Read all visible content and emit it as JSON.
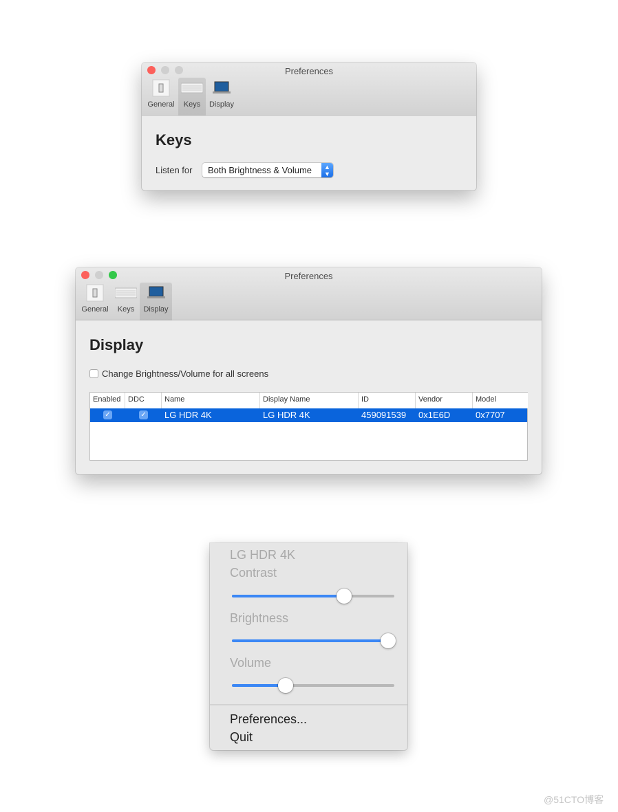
{
  "keys_window": {
    "title": "Preferences",
    "toolbar": [
      {
        "label": "General",
        "icon": "switch-icon"
      },
      {
        "label": "Keys",
        "icon": "keyboard-icon",
        "selected": true
      },
      {
        "label": "Display",
        "icon": "laptop-icon"
      }
    ],
    "heading": "Keys",
    "listen_label": "Listen for",
    "listen_value": "Both Brightness & Volume"
  },
  "display_window": {
    "title": "Preferences",
    "toolbar": [
      {
        "label": "General",
        "icon": "switch-icon"
      },
      {
        "label": "Keys",
        "icon": "keyboard-icon"
      },
      {
        "label": "Display",
        "icon": "laptop-icon",
        "selected": true
      }
    ],
    "heading": "Display",
    "all_screens_label": "Change Brightness/Volume for all screens",
    "all_screens_checked": false,
    "table": {
      "columns": [
        "Enabled",
        "DDC",
        "Name",
        "Display Name",
        "ID",
        "Vendor",
        "Model"
      ],
      "rows": [
        {
          "enabled": true,
          "ddc": true,
          "name": "LG HDR 4K",
          "display_name": "LG HDR 4K",
          "id": "459091539",
          "vendor": "0x1E6D",
          "model": "0x7707",
          "selected": true
        }
      ]
    }
  },
  "menu": {
    "display": "LG HDR 4K",
    "contrast_label": "Contrast",
    "contrast": 0.69,
    "brightness_label": "Brightness",
    "brightness": 0.96,
    "volume_label": "Volume",
    "volume": 0.33,
    "preferences": "Preferences...",
    "quit": "Quit"
  },
  "colors": {
    "accent": "#0a64dc",
    "slider": "#3b87f5"
  },
  "watermark": "@51CTO博客"
}
